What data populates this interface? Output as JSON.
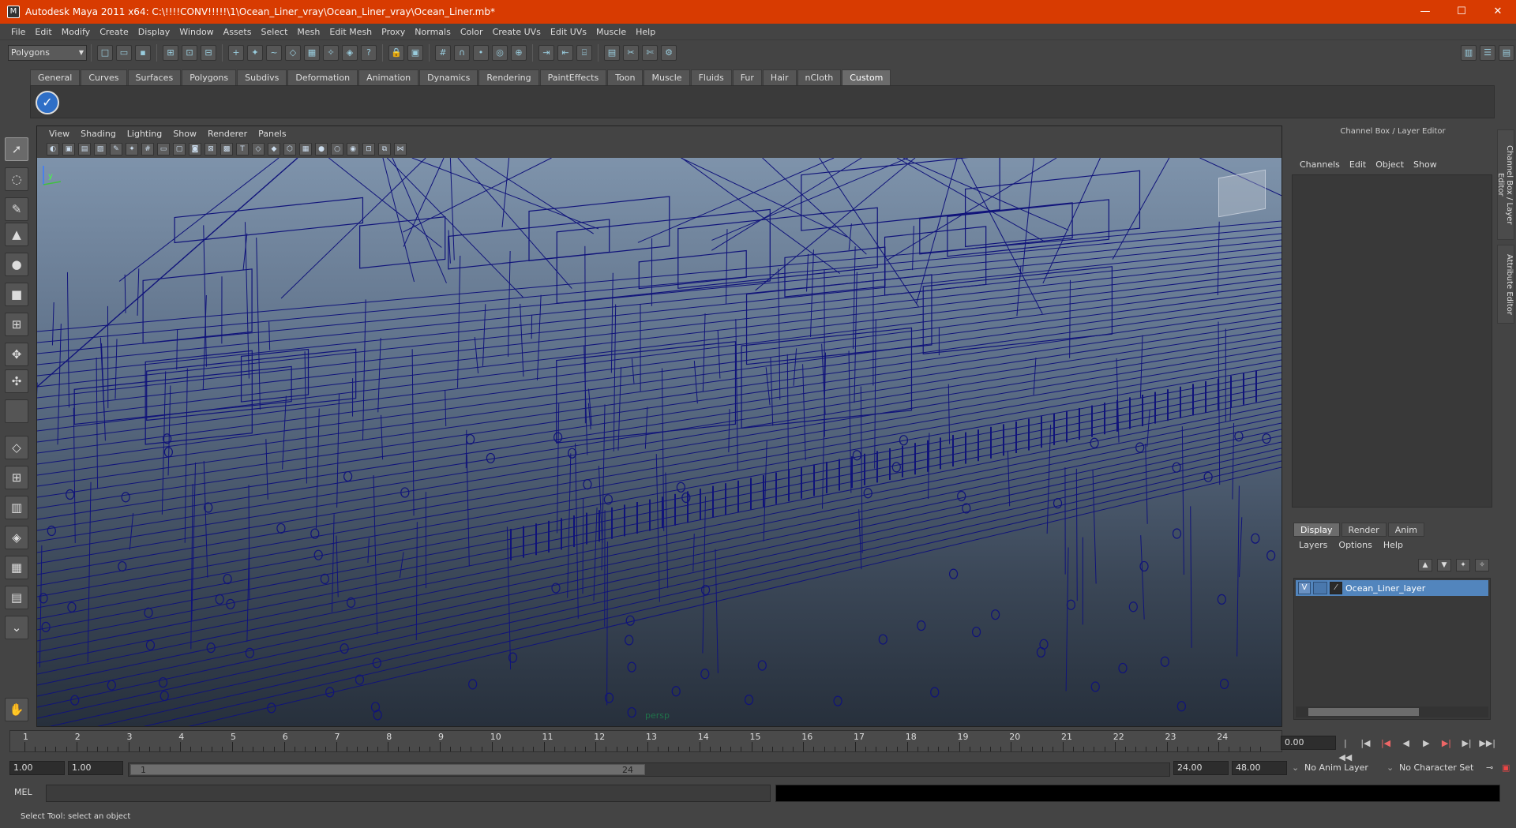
{
  "window": {
    "title": "Autodesk Maya 2011 x64: C:\\!!!!CONV!!!!!\\1\\Ocean_Liner_vray\\Ocean_Liner_vray\\Ocean_Liner.mb*",
    "minimize": "—",
    "maximize": "☐",
    "close": "✕"
  },
  "menubar": [
    "File",
    "Edit",
    "Modify",
    "Create",
    "Display",
    "Window",
    "Assets",
    "Select",
    "Mesh",
    "Edit Mesh",
    "Proxy",
    "Normals",
    "Color",
    "Create UVs",
    "Edit UVs",
    "Muscle",
    "Help"
  ],
  "statusline": {
    "mode": "Polygons"
  },
  "shelf": {
    "tabs": [
      "General",
      "Curves",
      "Surfaces",
      "Polygons",
      "Subdivs",
      "Deformation",
      "Animation",
      "Dynamics",
      "Rendering",
      "PaintEffects",
      "Toon",
      "Muscle",
      "Fluids",
      "Fur",
      "Hair",
      "nCloth",
      "Custom"
    ],
    "active_tab": "Custom"
  },
  "viewport": {
    "menu": [
      "View",
      "Shading",
      "Lighting",
      "Show",
      "Renderer",
      "Panels"
    ],
    "camera_label": "persp",
    "axis_y": "y",
    "wire_color": "#10137a"
  },
  "channel_box": {
    "header": "Channel Box / Layer Editor",
    "menu": [
      "Channels",
      "Edit",
      "Object",
      "Show"
    ],
    "side_tabs": [
      "Channel Box / Layer Editor",
      "Attribute Editor"
    ]
  },
  "layer_editor": {
    "tabs": [
      "Display",
      "Render",
      "Anim"
    ],
    "active_tab": "Display",
    "menu": [
      "Layers",
      "Options",
      "Help"
    ],
    "layer": {
      "visible": "V",
      "name": "Ocean_Liner_layer"
    }
  },
  "timeline": {
    "ticks": [
      "1",
      "2",
      "3",
      "4",
      "5",
      "6",
      "7",
      "8",
      "9",
      "10",
      "11",
      "12",
      "13",
      "14",
      "15",
      "16",
      "17",
      "18",
      "19",
      "20",
      "21",
      "22",
      "23",
      "24"
    ],
    "current_frame": "0.00"
  },
  "range": {
    "start_anim": "1.00",
    "start_range": "1.00",
    "slider_start": "1",
    "slider_end": "24",
    "end_range": "24.00",
    "end_anim": "48.00",
    "anim_layer": "No Anim Layer",
    "character_set": "No Character Set"
  },
  "command": {
    "label": "MEL"
  },
  "help_line": "Select Tool: select an object"
}
